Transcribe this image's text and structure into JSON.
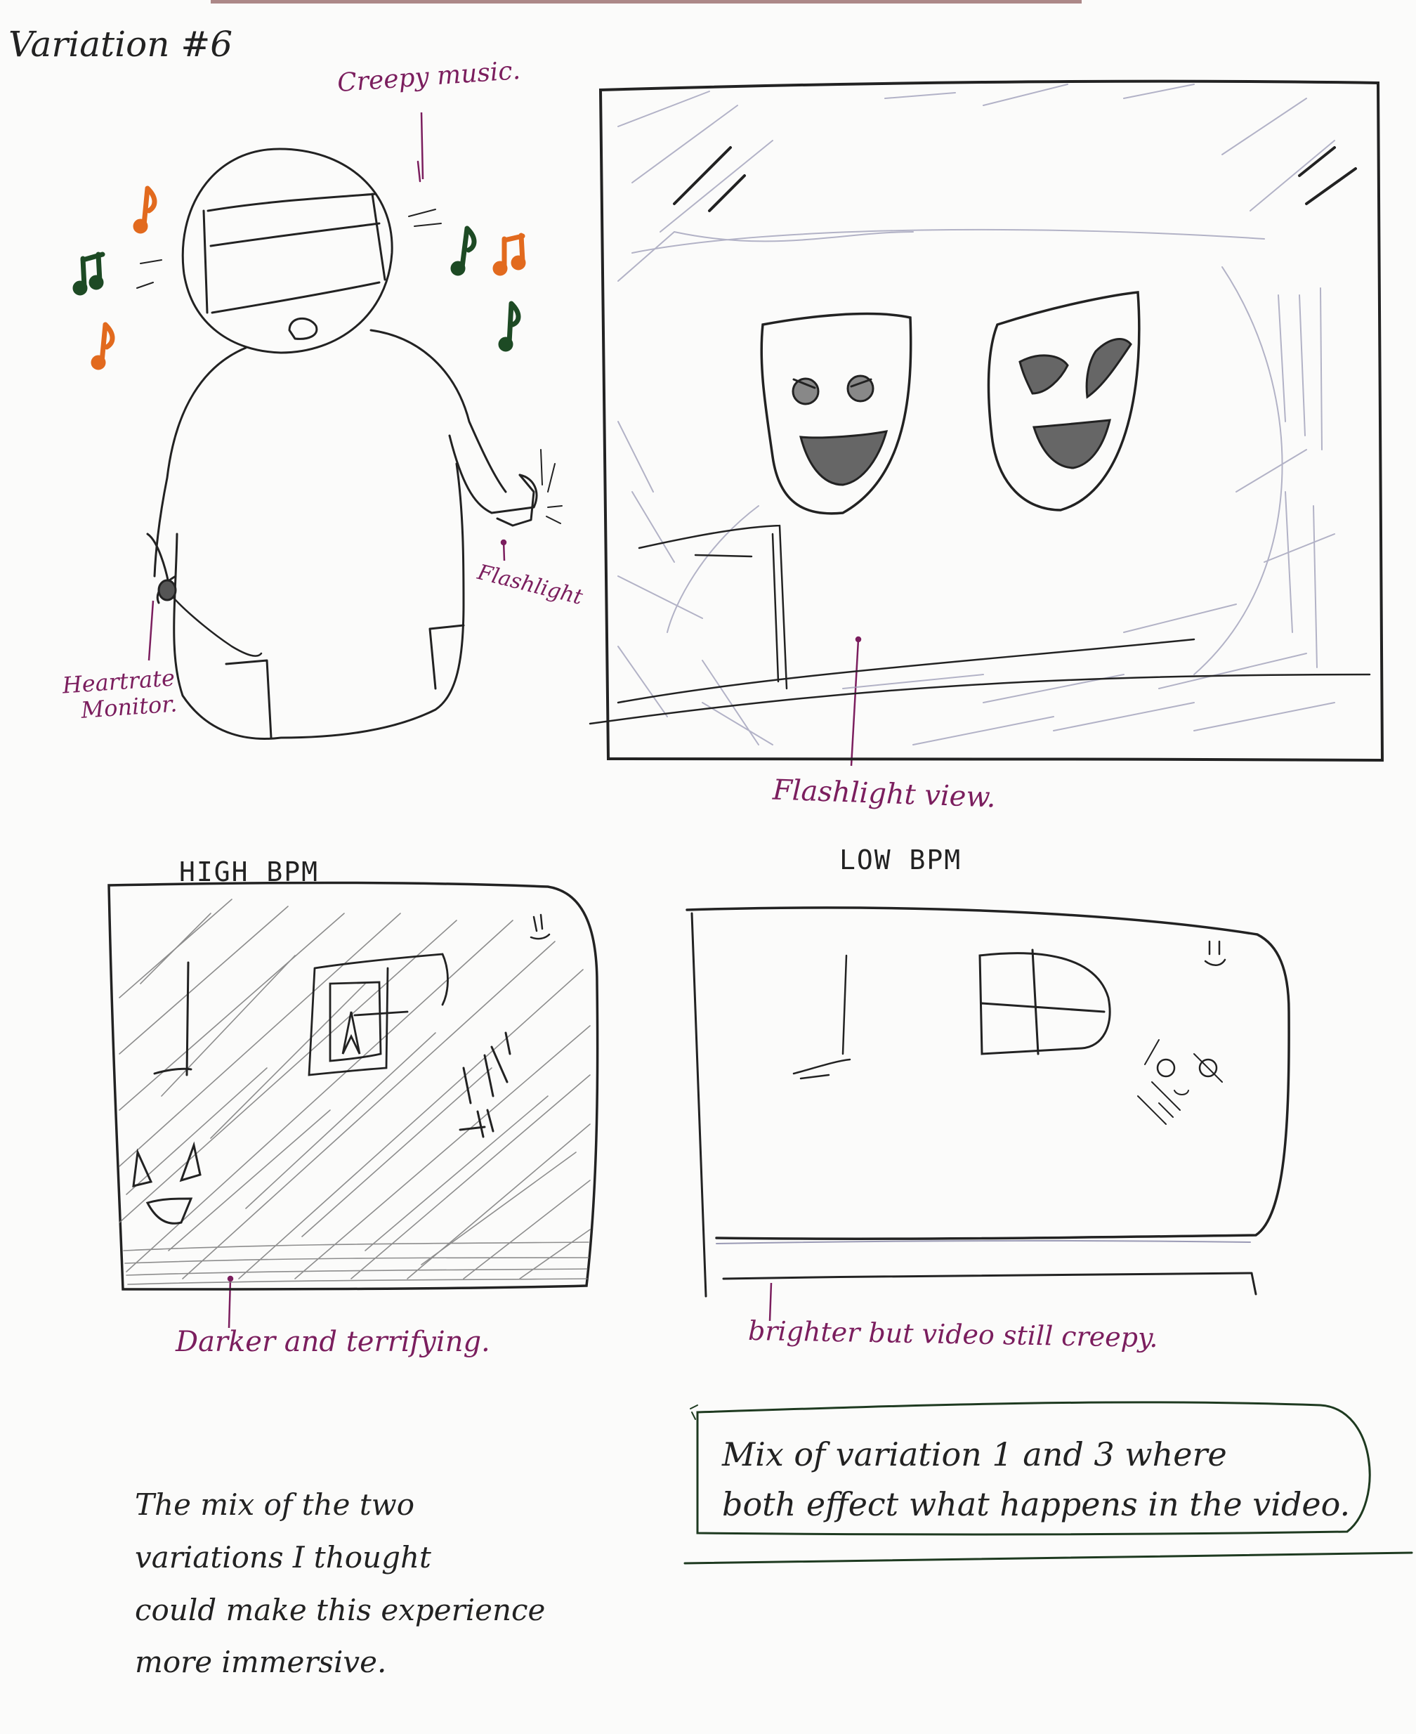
{
  "title": "Variation #6",
  "labels": {
    "creepy_music": "Creepy music.",
    "flashlight": "Flashlight",
    "heartrate_monitor_line1": "Heartrate",
    "heartrate_monitor_line2": "Monitor.",
    "flashlight_view": "Flashlight view."
  },
  "panels": {
    "high": {
      "heading": "HIGH BPM",
      "caption": "Darker and terrifying."
    },
    "low": {
      "heading": "LOW BPM",
      "caption": "brighter but video still creepy."
    }
  },
  "notes": {
    "boxed": {
      "line1": "Mix of variation 1 and 3 where",
      "line2": "both effect what happens in the video."
    },
    "free": {
      "line1": "The mix of the two",
      "line2": "variations I thought",
      "line3": "could make this experience",
      "line4": "more immersive."
    }
  },
  "colors": {
    "pencil": "#222222",
    "annotation": "#7b1e5e",
    "note_green": "#1d4a24",
    "note_orange": "#e26a1e",
    "paper": "#fbfbfa"
  }
}
